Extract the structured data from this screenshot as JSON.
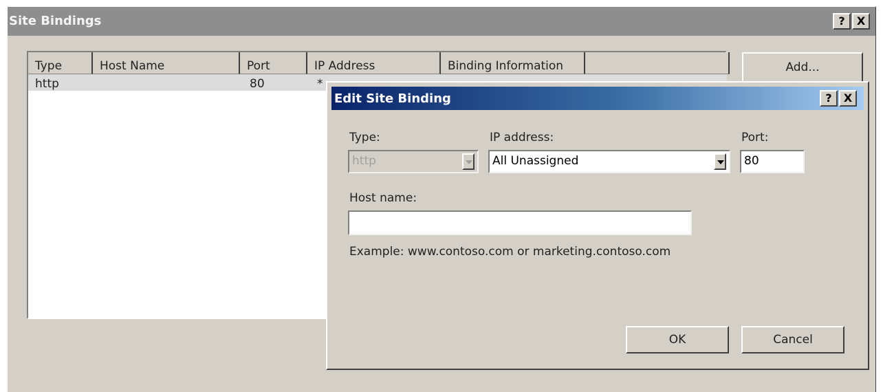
{
  "window": {
    "title": "Site Bindings",
    "help_label": "?",
    "close_label": "X"
  },
  "bindings_table": {
    "columns": [
      "Type",
      "Host Name",
      "Port",
      "IP Address",
      "Binding Information",
      ""
    ],
    "rows": [
      {
        "type": "http",
        "host_name": "",
        "port": "80",
        "ip_address": "*",
        "binding_information": ""
      }
    ]
  },
  "buttons": {
    "add": "Add..."
  },
  "dialog": {
    "title": "Edit Site Binding",
    "help_label": "?",
    "close_label": "X",
    "type_label": "Type:",
    "type_value": "http",
    "ip_label": "IP address:",
    "ip_value": "All Unassigned",
    "port_label": "Port:",
    "port_value": "80",
    "host_label": "Host name:",
    "host_value": "",
    "example_text": "Example: www.contoso.com or marketing.contoso.com",
    "ok_label": "OK",
    "cancel_label": "Cancel"
  },
  "colors": {
    "window_face": "#d4d0c8",
    "inactive_title": "#8e8e8e",
    "active_title_start": "#0a246a",
    "active_title_end": "#a6caf0"
  }
}
